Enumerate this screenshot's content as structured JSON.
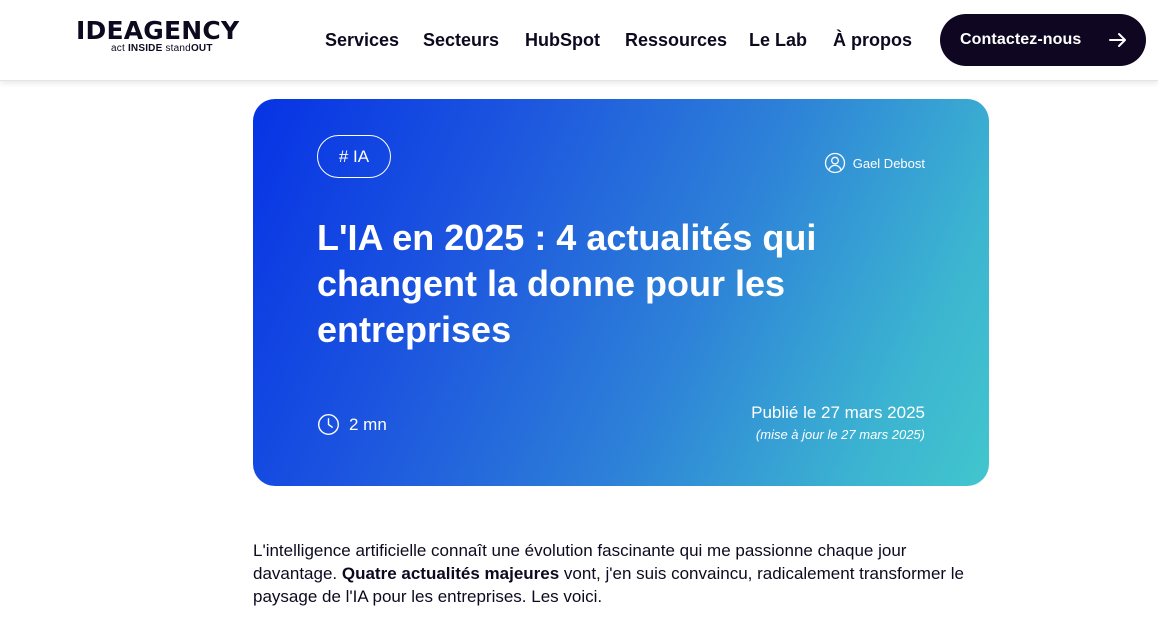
{
  "brand": {
    "logo_main": "IDEAGENCY",
    "tag_act": "act",
    "tag_inside": "INSIDE",
    "tag_stand": "stand",
    "tag_out": "OUT"
  },
  "nav": {
    "items": [
      {
        "label": "Services"
      },
      {
        "label": "Secteurs"
      },
      {
        "label": "HubSpot"
      },
      {
        "label": "Ressources"
      },
      {
        "label": "Le Lab"
      },
      {
        "label": "À propos"
      }
    ],
    "cta_label": "Contactez-nous"
  },
  "article": {
    "tag": "# IA",
    "author": "Gael Debost",
    "title": "L'IA en 2025 : 4 actualités qui changent la donne pour les entreprises",
    "read_time": "2 mn",
    "published": "Publié le 27 mars 2025",
    "updated": "(mise à jour le 27 mars 2025)"
  },
  "intro": {
    "part1": "L'intelligence artificielle connaît une évolution fascinante qui me passionne chaque jour davantage. ",
    "bold": "Quatre actualités majeures",
    "part2": " vont, j'en suis convaincu, radicalement transformer le paysage de l'IA pour les entreprises. Les voici."
  },
  "colors": {
    "dark": "#0d0a1f",
    "cta_bg": "#0f0722",
    "gradient_start": "#0633e5",
    "gradient_end": "#42c6cd"
  },
  "icons": {
    "cta": "arrow-right-icon",
    "author": "user-circle-icon",
    "read_time": "clock-icon"
  }
}
